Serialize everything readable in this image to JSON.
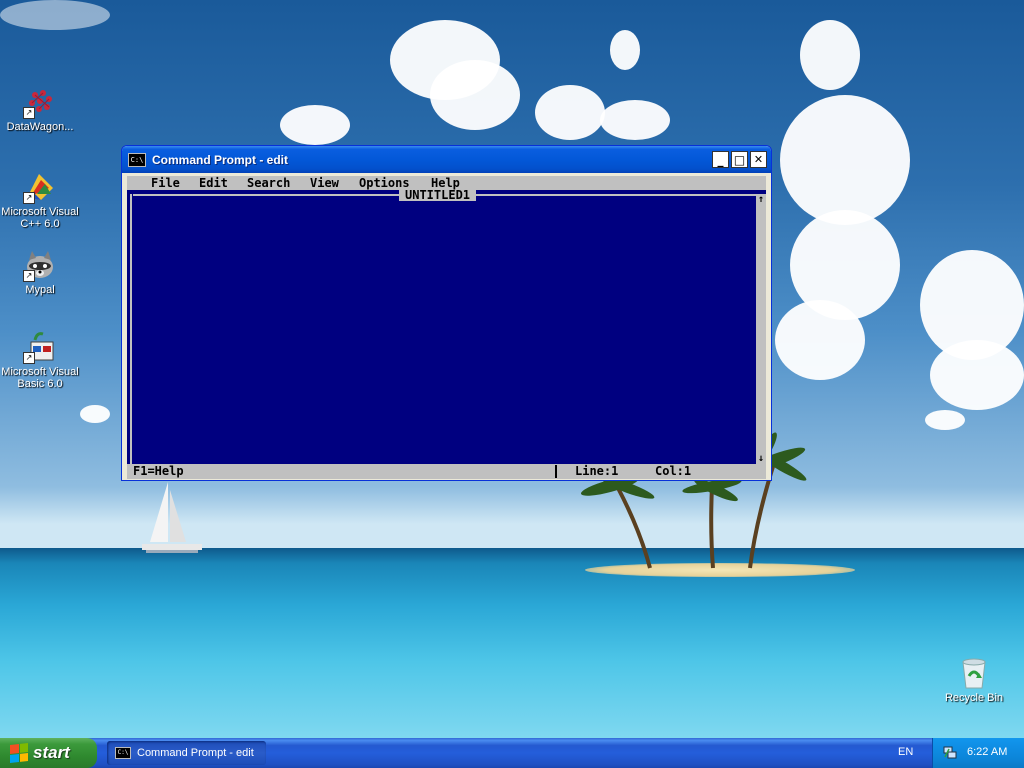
{
  "desktop": {
    "icons": [
      {
        "label": "DataWagon..."
      },
      {
        "label": "Microsoft Visual C++ 6.0"
      },
      {
        "label": "Mypal"
      },
      {
        "label": "Microsoft Visual Basic 6.0"
      },
      {
        "label": "Recycle Bin"
      }
    ]
  },
  "window": {
    "title": "Command Prompt - edit",
    "icon": "console-icon",
    "buttons": {
      "minimize": "_",
      "maximize": "□",
      "close": "✕"
    }
  },
  "editor": {
    "menu": [
      "File",
      "Edit",
      "Search",
      "View",
      "Options",
      "Help"
    ],
    "document_name": "UNTITLED1",
    "status_help": "F1=Help",
    "line": "Line:1",
    "col": "Col:1",
    "scroll_up": "↑",
    "scroll_down": "↓"
  },
  "taskbar": {
    "start_label": "start",
    "items": [
      {
        "label": "Command Prompt - edit"
      }
    ],
    "language": "EN",
    "clock": "6:22 AM"
  },
  "colors": {
    "editor_background": "#000080",
    "console_chrome": "#c0c0c0",
    "titlebar": "#0358d8",
    "taskbar": "#245edb",
    "start_button": "#3c9a3c"
  }
}
